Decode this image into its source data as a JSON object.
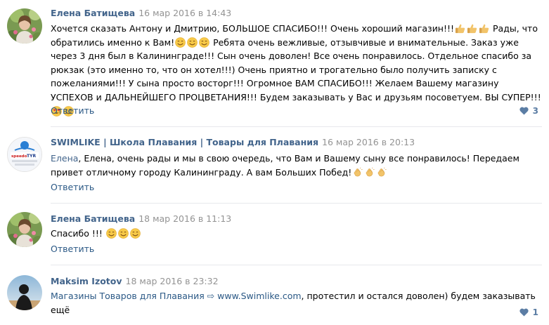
{
  "comments": [
    {
      "author": "Елена Батищева",
      "date": "16 мар 2016 в 14:43",
      "avatar": "woman-photo",
      "text_parts": [
        "Хочется сказать Антону и Дмитрию, БОЛЬШОЕ СПАСИБО!!! Очень хороший магазин!!!",
        " Рады, что обратились именно к Вам!",
        " Ребята очень вежливые, отзывчивые и внимательные. Заказ уже через 3 дня был в Калининграде!!! Сын очень доволен! Все очень понравилось. Отдельное спасибо за рюкзак (это именно то, что он хотел!!!) Очень приятно и трогательно было получить записку с пожеланиями!!! У сына просто восторг!!! Огромное ВАМ СПАСИБО!!! Желаем Вашему магазину УСПЕХОВ и ДАЛЬНЕЙШЕГО ПРОЦВЕТАНИЯ!!! Будем заказывать у Вас и друзьям посоветуем. ВЫ СУПЕР!!!"
      ],
      "emojis": [
        "thumbs-up-icon",
        "smile-icon",
        "heart-eyes-icon"
      ],
      "reply_label": "Ответить",
      "likes": "3"
    },
    {
      "author": "SWIMLIKE | Школа Плавания | Товары для Плавания",
      "date": "16 мар 2016 в 20:13",
      "avatar": "swimlike-logo",
      "reply_to": "Елена",
      "text": ", Елена, очень рады и мы в свою очередь, что Вам и Вашему сыну все понравилось! Передаем привет отличному городу Калининграду. А вам Больших Побед!",
      "emojis": [
        "clapping-hands-icon"
      ],
      "reply_label": "Ответить"
    },
    {
      "author": "Елена Батищева",
      "date": "18 мар 2016 в 11:13",
      "avatar": "woman-photo",
      "text": "Спасибо !!!",
      "emojis": [
        "smile-icon"
      ],
      "reply_label": "Ответить"
    },
    {
      "author": "Maksim Izotov",
      "date": "18 мар 2016 в 23:32",
      "avatar": "silhouette-photo",
      "text_link": "Магазины Товаров для Плавания ⇨ www.Swimlike.com",
      "text": ", протестил и остался доволен) будем заказывать ещё",
      "likes": "1"
    }
  ],
  "colors": {
    "author": "#42648b",
    "date": "#939393",
    "link": "#2a5885",
    "likes": "#5b7da4",
    "divider": "#e7e8ec"
  }
}
